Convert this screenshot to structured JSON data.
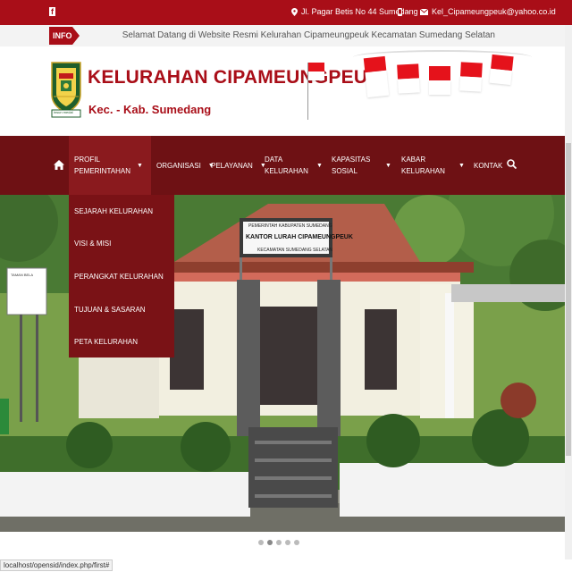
{
  "topbar": {
    "facebook": "f",
    "address": "Jl. Pagar Betis No 44 Sumedang",
    "phone": "-",
    "email": "Kel_Cipameungpeuk@yahoo.co.id"
  },
  "info": {
    "tag": "INFO",
    "text": "Selamat Datang di Website Resmi Kelurahan Cipameungpeuk Kecamatan Sumedang Selatan"
  },
  "header": {
    "title": "KELURAHAN CIPAMEUNGPEUK",
    "subtitle": "Kec. - Kab. Sumedang",
    "logo_text": "insun medal"
  },
  "nav": {
    "items": [
      {
        "label": "PROFIL PEMERINTAHAN"
      },
      {
        "label": "ORGANISASI"
      },
      {
        "label": "PELAYANAN"
      },
      {
        "label": "DATA KELURAHAN"
      },
      {
        "label": "KAPASITAS SOSIAL"
      },
      {
        "label": "KABAR KELURAHAN"
      },
      {
        "label": "KONTAK"
      }
    ]
  },
  "dropdown": {
    "items": [
      "SEJARAH KELURAHAN",
      "VISI & MISI",
      "PERANGKAT KELURAHAN",
      "TUJUAN & SASARAN",
      "PETA KELURAHAN"
    ]
  },
  "hero": {
    "sign1": "PEMERINTAH KABUPATEN SUMEDANG",
    "sign2": "KANTOR LURAH CIPAMEUNGPEUK",
    "sign3": "KECAMATAN SUMEDANG SELATAN",
    "board_title": "TAMAN BELA"
  },
  "carousel": {
    "slides": 5,
    "active": 1
  },
  "status_url": "localhost/opensid/index.php/first#",
  "colors": {
    "brand": "#a90e18",
    "nav": "#6e1114"
  },
  "icons": [
    "facebook-icon",
    "map-marker-icon",
    "phone-icon",
    "envelope-icon",
    "home-icon",
    "search-icon"
  ]
}
